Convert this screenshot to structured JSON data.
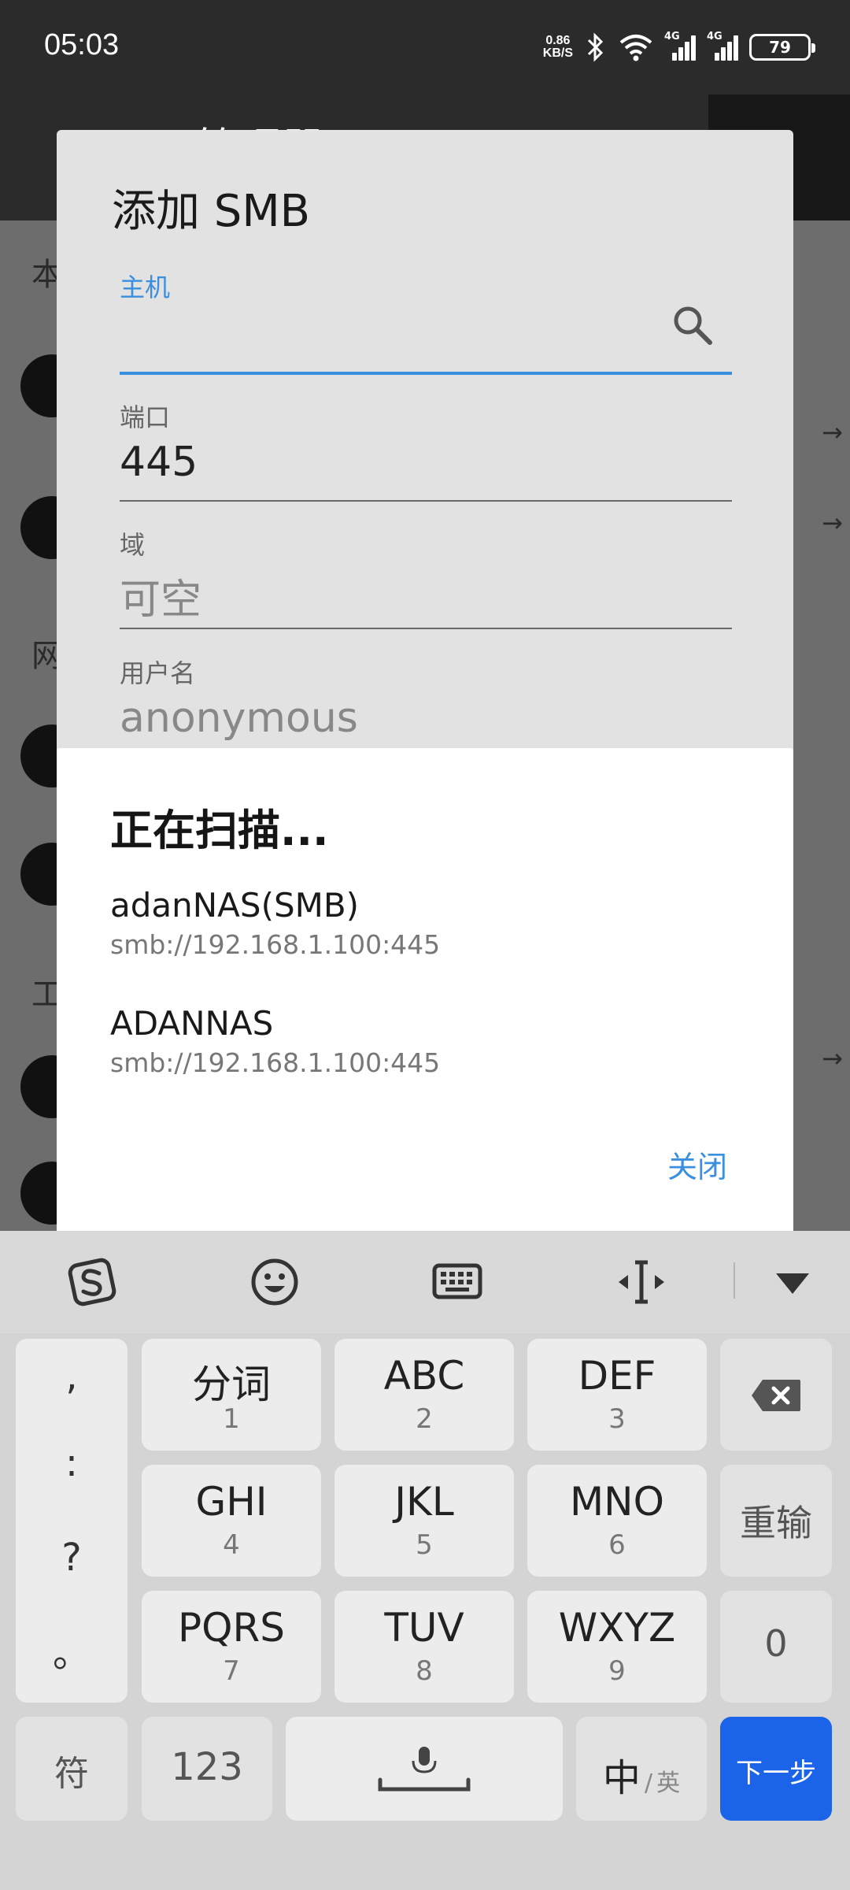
{
  "status_bar": {
    "time": "05:03",
    "net_speed_value": "0.86",
    "net_speed_unit": "KB/S",
    "signal1_label": "4G",
    "signal2_label": "4G",
    "battery": "79"
  },
  "background_app": {
    "title": "MT管理器",
    "section_1": "本",
    "section_2": "网",
    "section_3": "工"
  },
  "smb_dialog": {
    "title": "添加 SMB",
    "host": {
      "label": "主机",
      "value": ""
    },
    "port": {
      "label": "端口",
      "value": "445"
    },
    "domain": {
      "label": "域",
      "placeholder": "可空"
    },
    "username": {
      "label": "用户名",
      "placeholder": "anonymous"
    }
  },
  "scan_dialog": {
    "title": "正在扫描...",
    "results": [
      {
        "name": "adanNAS(SMB)",
        "url": "smb://192.168.1.100:445"
      },
      {
        "name": "ADANNAS",
        "url": "smb://192.168.1.100:445"
      }
    ],
    "close_label": "关闭"
  },
  "keyboard": {
    "punctuation": [
      ",",
      ":",
      "?",
      "。"
    ],
    "keys": [
      {
        "main": "分词",
        "sub": "1"
      },
      {
        "main": "ABC",
        "sub": "2"
      },
      {
        "main": "DEF",
        "sub": "3"
      },
      {
        "main": "GHI",
        "sub": "4"
      },
      {
        "main": "JKL",
        "sub": "5"
      },
      {
        "main": "MNO",
        "sub": "6"
      },
      {
        "main": "PQRS",
        "sub": "7"
      },
      {
        "main": "TUV",
        "sub": "8"
      },
      {
        "main": "WXYZ",
        "sub": "9"
      }
    ],
    "retype_label": "重输",
    "zero_label": "0",
    "symbol_label": "符",
    "num_label": "123",
    "lang_main": "中",
    "lang_sep": "/",
    "lang_alt": "英",
    "next_label": "下一步"
  },
  "colors": {
    "accent": "#3b8fe0",
    "next_key": "#1b63e8"
  }
}
